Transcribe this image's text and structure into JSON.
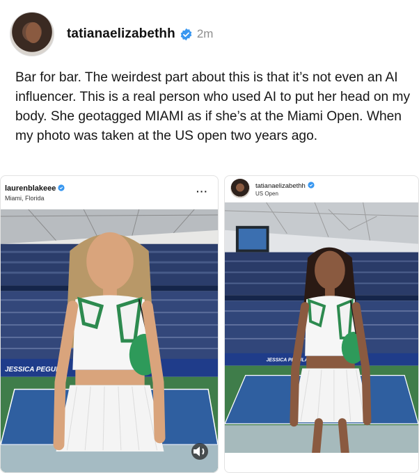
{
  "post": {
    "username": "tatianaelizabethh",
    "timestamp": "2m",
    "caption": "Bar for bar. The weirdest part about this is that it’s not even an AI influencer. This is a real person who used AI to put her head on my body. She geotagged MIAMI as if she’s at the Miami Open. When my photo was taken at the US open two years ago."
  },
  "left_card": {
    "username": "laurenblakeee",
    "location": "Miami, Florida",
    "banner_text": "JESSICA PEGULA",
    "more_icon": "ellipsis-icon",
    "sound_icon": "speaker-icon"
  },
  "right_card": {
    "username": "tatianaelizabethh",
    "location": "US Open",
    "banner_text": "JESSICA PEGULA"
  },
  "colors": {
    "verified_blue": "#3897f0",
    "muted_text": "#8e8e8e",
    "court_green": "#3f7d4a",
    "court_blue": "#2f5fa0",
    "stadium_navy": "#1f2f5a"
  }
}
